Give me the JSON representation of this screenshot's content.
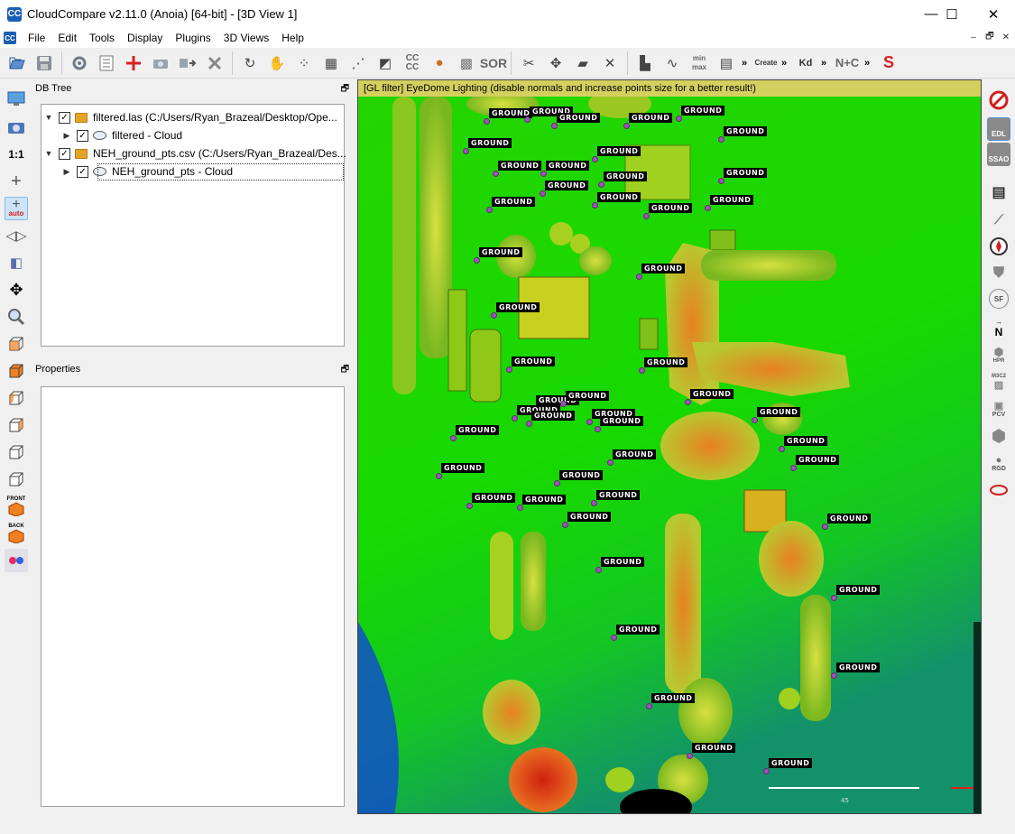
{
  "window": {
    "title": "CloudCompare v2.11.0 (Anoia) [64-bit] - [3D View 1]",
    "logo_text": "CC",
    "minimize": "—",
    "maximize": "☐",
    "close": "✕"
  },
  "menu": {
    "items": [
      "File",
      "Edit",
      "Tools",
      "Display",
      "Plugins",
      "3D Views",
      "Help"
    ],
    "mdi_minimize": "–",
    "mdi_restore": "🗗",
    "mdi_close": "✕"
  },
  "toolbar": {
    "sor": "SOR",
    "cccc": "CC\nCC",
    "minmax": "min\nmax",
    "canupo": "Create",
    "kd": "Kd",
    "nc": "N+C",
    "more": "»"
  },
  "left_toolbar": {
    "one_to_one": "1:1",
    "auto": "auto",
    "front": "FRONT",
    "back": "BACK"
  },
  "db_tree": {
    "title": "DB Tree",
    "float_icon": "🗗",
    "items": [
      {
        "label": "filtered.las (C:/Users/Ryan_Brazeal/Desktop/Ope...",
        "type": "folder"
      },
      {
        "label": "filtered - Cloud",
        "type": "cloud"
      },
      {
        "label": "NEH_ground_pts.csv (C:/Users/Ryan_Brazeal/Des...",
        "type": "folder"
      },
      {
        "label": "NEH_ground_pts - Cloud",
        "type": "cloud"
      }
    ]
  },
  "properties": {
    "title": "Properties",
    "float_icon": "🗗"
  },
  "view3d": {
    "gl_filter_text": "[GL filter] EyeDome Lighting (disable normals and increase points size for a better result!)",
    "scale_label": "45",
    "ground_label": "GROUND",
    "ground_points_count": 42
  },
  "right_toolbar": {
    "edl": "EDL",
    "ssao": "SSAO",
    "sf": "SF",
    "north": "N",
    "hpr": "HPR",
    "m3c2": "M3C2",
    "pcv": "PCV",
    "rgd": "RGD"
  },
  "colors": {
    "ground_tag_bg": "#000000",
    "ground_dot": "#a050c0",
    "terrain_green": "#20d000",
    "gl_filter_bar": "#d4d060"
  }
}
